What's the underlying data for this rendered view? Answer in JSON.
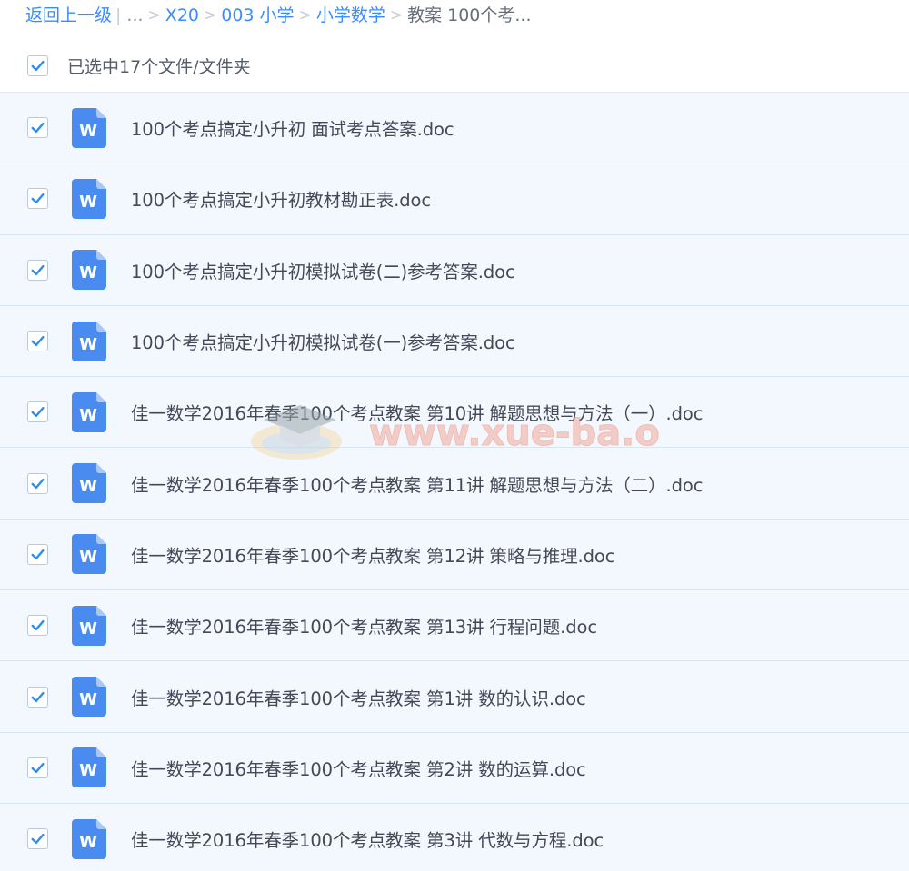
{
  "breadcrumb": {
    "back": "返回上一级",
    "pipe": "|",
    "ellipsis": "...",
    "sep": ">",
    "items": [
      "X20",
      "003 小学",
      "小学数学"
    ],
    "current": "教案 100个考..."
  },
  "selection": {
    "label": "已选中17个文件/文件夹",
    "checked": true
  },
  "files": [
    {
      "name": "100个考点搞定小升初 面试考点答案.doc",
      "icon": "word-doc-icon",
      "checked": true
    },
    {
      "name": "100个考点搞定小升初教材勘正表.doc",
      "icon": "word-doc-icon",
      "checked": true
    },
    {
      "name": "100个考点搞定小升初模拟试卷(二)参考答案.doc",
      "icon": "word-doc-icon",
      "checked": true
    },
    {
      "name": "100个考点搞定小升初模拟试卷(一)参考答案.doc",
      "icon": "word-doc-icon",
      "checked": true
    },
    {
      "name": "佳一数学2016年春季100个考点教案 第10讲 解题思想与方法（一）.doc",
      "icon": "word-doc-icon",
      "checked": true
    },
    {
      "name": "佳一数学2016年春季100个考点教案 第11讲 解题思想与方法（二）.doc",
      "icon": "word-doc-icon",
      "checked": true
    },
    {
      "name": "佳一数学2016年春季100个考点教案 第12讲 策略与推理.doc",
      "icon": "word-doc-icon",
      "checked": true
    },
    {
      "name": "佳一数学2016年春季100个考点教案 第13讲 行程问题.doc",
      "icon": "word-doc-icon",
      "checked": true
    },
    {
      "name": "佳一数学2016年春季100个考点教案 第1讲 数的认识.doc",
      "icon": "word-doc-icon",
      "checked": true
    },
    {
      "name": "佳一数学2016年春季100个考点教案 第2讲 数的运算.doc",
      "icon": "word-doc-icon",
      "checked": true
    },
    {
      "name": "佳一数学2016年春季100个考点教案 第3讲 代数与方程.doc",
      "icon": "word-doc-icon",
      "checked": true
    }
  ],
  "file_icon_letter": "W",
  "watermark": {
    "text": "www.xue-ba.org"
  },
  "colors": {
    "link": "#3b8cff",
    "check": "#2f8fe8",
    "word_icon": "#4a8bf0",
    "row_bg": "#f3f8fe",
    "row_border": "#d7e6f4"
  }
}
